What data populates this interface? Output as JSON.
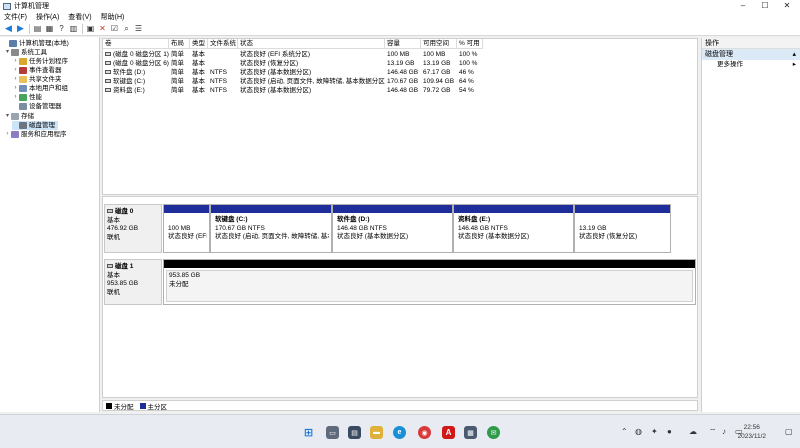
{
  "window": {
    "title": "计算机管理"
  },
  "menu": [
    "文件(F)",
    "操作(A)",
    "查看(V)",
    "帮助(H)"
  ],
  "tree": {
    "items": [
      {
        "label": "计算机管理(本地)",
        "level": 0,
        "expander": "",
        "icon": "computer-icon"
      },
      {
        "label": "系统工具",
        "level": 1,
        "expander": "▾",
        "icon": "tools-icon"
      },
      {
        "label": "任务计划程序",
        "level": 2,
        "expander": "›",
        "icon": "clock-icon"
      },
      {
        "label": "事件查看器",
        "level": 2,
        "expander": "›",
        "icon": "event-icon"
      },
      {
        "label": "共享文件夹",
        "level": 2,
        "expander": "›",
        "icon": "folder-icon"
      },
      {
        "label": "本地用户和组",
        "level": 2,
        "expander": "›",
        "icon": "users-icon"
      },
      {
        "label": "性能",
        "level": 2,
        "expander": "›",
        "icon": "perf-icon"
      },
      {
        "label": "设备管理器",
        "level": 2,
        "expander": "",
        "icon": "device-icon"
      },
      {
        "label": "存储",
        "level": 1,
        "expander": "▾",
        "icon": "storage-icon"
      },
      {
        "label": "磁盘管理",
        "level": 2,
        "expander": "",
        "icon": "disk-icon",
        "selected": true
      },
      {
        "label": "服务和应用程序",
        "level": 1,
        "expander": "›",
        "icon": "services-icon"
      }
    ]
  },
  "volumes": {
    "columns": [
      "卷",
      "布局",
      "类型",
      "文件系统",
      "状态",
      "容量",
      "可用空间",
      "% 可用"
    ],
    "rows": [
      [
        "(磁盘 0 磁盘分区 1)",
        "简单",
        "基本",
        "",
        "状态良好 (EFI 系统分区)",
        "100 MB",
        "100 MB",
        "100 %"
      ],
      [
        "(磁盘 0 磁盘分区 6)",
        "简单",
        "基本",
        "",
        "状态良好 (恢复分区)",
        "13.19 GB",
        "13.19 GB",
        "100 %"
      ],
      [
        "软件盘 (D:)",
        "简单",
        "基本",
        "NTFS",
        "状态良好 (基本数据分区)",
        "146.48 GB",
        "67.17 GB",
        "46 %"
      ],
      [
        "软键盘 (C:)",
        "简单",
        "基本",
        "NTFS",
        "状态良好 (启动, 页面文件, 故障转储, 基本数据分区)",
        "170.67 GB",
        "109.94 GB",
        "64 %"
      ],
      [
        "资料盘 (E:)",
        "简单",
        "基本",
        "NTFS",
        "状态良好 (基本数据分区)",
        "146.48 GB",
        "79.72 GB",
        "54 %"
      ]
    ]
  },
  "disks": [
    {
      "name": "磁盘 0",
      "type": "基本",
      "size": "476.92 GB",
      "status": "联机",
      "partitions": [
        {
          "name": "",
          "size": "100 MB",
          "status": "状态良好 (EFI",
          "kind": "primary"
        },
        {
          "name": "软键盘 (C:)",
          "size": "170.67 GB NTFS",
          "status": "状态良好 (启动, 页面文件, 故障转储, 基本",
          "kind": "primary"
        },
        {
          "name": "软件盘 (D:)",
          "size": "146.48 GB NTFS",
          "status": "状态良好 (基本数据分区)",
          "kind": "primary"
        },
        {
          "name": "资料盘 (E:)",
          "size": "146.48 GB NTFS",
          "status": "状态良好 (基本数据分区)",
          "kind": "primary"
        },
        {
          "name": "",
          "size": "13.19 GB",
          "status": "状态良好 (恢复分区)",
          "kind": "primary"
        }
      ]
    },
    {
      "name": "磁盘 1",
      "type": "基本",
      "size": "953.85 GB",
      "status": "联机",
      "partitions": [
        {
          "name": "",
          "size": "953.85 GB",
          "status": "未分配",
          "kind": "unallocated"
        }
      ]
    }
  ],
  "legend": [
    {
      "label": "未分配",
      "color": "#000000"
    },
    {
      "label": "主分区",
      "color": "#1e2d9a"
    }
  ],
  "actions": {
    "header": "操作",
    "section": "磁盘管理",
    "more": "更多操作"
  },
  "taskbar": {
    "clock_time": "22:56",
    "clock_date": "2023/11/2"
  }
}
